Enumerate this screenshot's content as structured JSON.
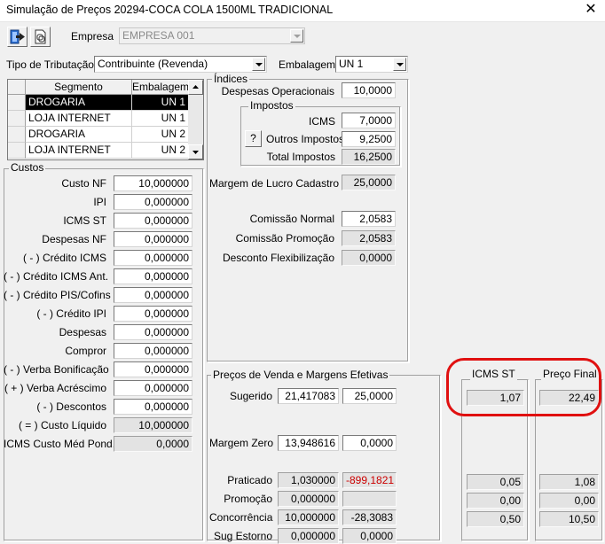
{
  "window": {
    "title": "Simulação de Preços  20294-COCA COLA 1500ML TRADICIONAL",
    "close_glyph": "✕"
  },
  "toolbar": {
    "exit_icon": "exit-door-icon",
    "doc_icon": "document-link-icon"
  },
  "empresa": {
    "label": "Empresa",
    "value": "EMPRESA 001"
  },
  "tributacao": {
    "label": "Tipo de Tributação",
    "value": "Contribuinte (Revenda)"
  },
  "embalagem": {
    "label": "Embalagem",
    "value": "UN  1"
  },
  "segment_grid": {
    "columns": [
      "Segmento",
      "Embalagem"
    ],
    "rows": [
      {
        "segmento": "DROGARIA",
        "embalagem": "UN  1",
        "selected": true
      },
      {
        "segmento": "LOJA INTERNET",
        "embalagem": "UN  1",
        "selected": false
      },
      {
        "segmento": "DROGARIA",
        "embalagem": "UN  2",
        "selected": false
      },
      {
        "segmento": "LOJA INTERNET",
        "embalagem": "UN  2",
        "selected": false
      }
    ]
  },
  "custos": {
    "title": "Custos",
    "rows": [
      {
        "label": "Custo NF",
        "value": "10,000000",
        "readonly": false
      },
      {
        "label": "IPI",
        "value": "0,000000",
        "readonly": false
      },
      {
        "label": "ICMS ST",
        "value": "0,000000",
        "readonly": false
      },
      {
        "label": "Despesas NF",
        "value": "0,000000",
        "readonly": false
      },
      {
        "label": "( - ) Crédito ICMS",
        "value": "0,000000",
        "readonly": false
      },
      {
        "label": "( - ) Crédito ICMS Ant.",
        "value": "0,000000",
        "readonly": false
      },
      {
        "label": "( - ) Crédito PIS/Cofins",
        "value": "0,000000",
        "readonly": false
      },
      {
        "label": "( - ) Crédito IPI",
        "value": "0,000000",
        "readonly": false
      },
      {
        "label": "Despesas",
        "value": "0,000000",
        "readonly": false
      },
      {
        "label": "Compror",
        "value": "0,000000",
        "readonly": false
      },
      {
        "label": "( - ) Verba Bonificação",
        "value": "0,000000",
        "readonly": false
      },
      {
        "label": "( + ) Verba Acréscimo",
        "value": "0,000000",
        "readonly": false
      },
      {
        "label": "( - ) Descontos",
        "value": "0,000000",
        "readonly": false
      },
      {
        "label": "( = ) Custo Líquido",
        "value": "10,000000",
        "readonly": true
      },
      {
        "label": "ICMS Custo Méd Pond.",
        "value": "0,0000",
        "readonly": true
      }
    ]
  },
  "indices": {
    "title": "Índices",
    "despesas_operacionais": {
      "label": "Despesas Operacionais",
      "value": "10,0000"
    },
    "impostos": {
      "title": "Impostos",
      "icms": {
        "label": "ICMS",
        "value": "7,0000"
      },
      "outros": {
        "label": "Outros Impostos",
        "value": "9,2500",
        "help": "?"
      },
      "total": {
        "label": "Total Impostos",
        "value": "16,2500"
      }
    },
    "margem_lucro": {
      "label": "Margem de Lucro Cadastro",
      "value": "25,0000"
    },
    "comissao_normal": {
      "label": "Comissão Normal",
      "value": "2,0583"
    },
    "comissao_promocao": {
      "label": "Comissão Promoção",
      "value": "2,0583"
    },
    "desconto_flex": {
      "label": "Desconto Flexibilização",
      "value": "0,0000"
    }
  },
  "precos": {
    "title": "Preços de Venda e Margens Efetivas",
    "sugerido": {
      "label": "Sugerido",
      "price": "21,417083",
      "margin": "25,0000"
    },
    "margem_zero": {
      "label": "Margem Zero",
      "price": "13,948616",
      "margin": "0,0000"
    },
    "praticado": {
      "label": "Praticado",
      "price": "1,030000",
      "margin": "-899,1821"
    },
    "promocao": {
      "label": "Promoção",
      "price": "0,000000",
      "margin": ""
    },
    "concorrencia": {
      "label": "Concorrência",
      "price": "10,000000",
      "margin": "-28,3083"
    },
    "sug_estorno": {
      "label": "Sug Estorno",
      "price": "0,000000",
      "margin": "0,0000"
    }
  },
  "icms_st_box": {
    "title": "ICMS ST",
    "sugerido": "1,07",
    "praticado": "0,05",
    "promocao": "0,00",
    "concorrencia": "0,50"
  },
  "preco_final_box": {
    "title": "Preço Final",
    "sugerido": "22,49",
    "praticado": "1,08",
    "promocao": "0,00",
    "concorrencia": "10,50"
  },
  "colors": {
    "highlight": "#e01010",
    "negative": "#cc0000",
    "selection": "#000000"
  }
}
